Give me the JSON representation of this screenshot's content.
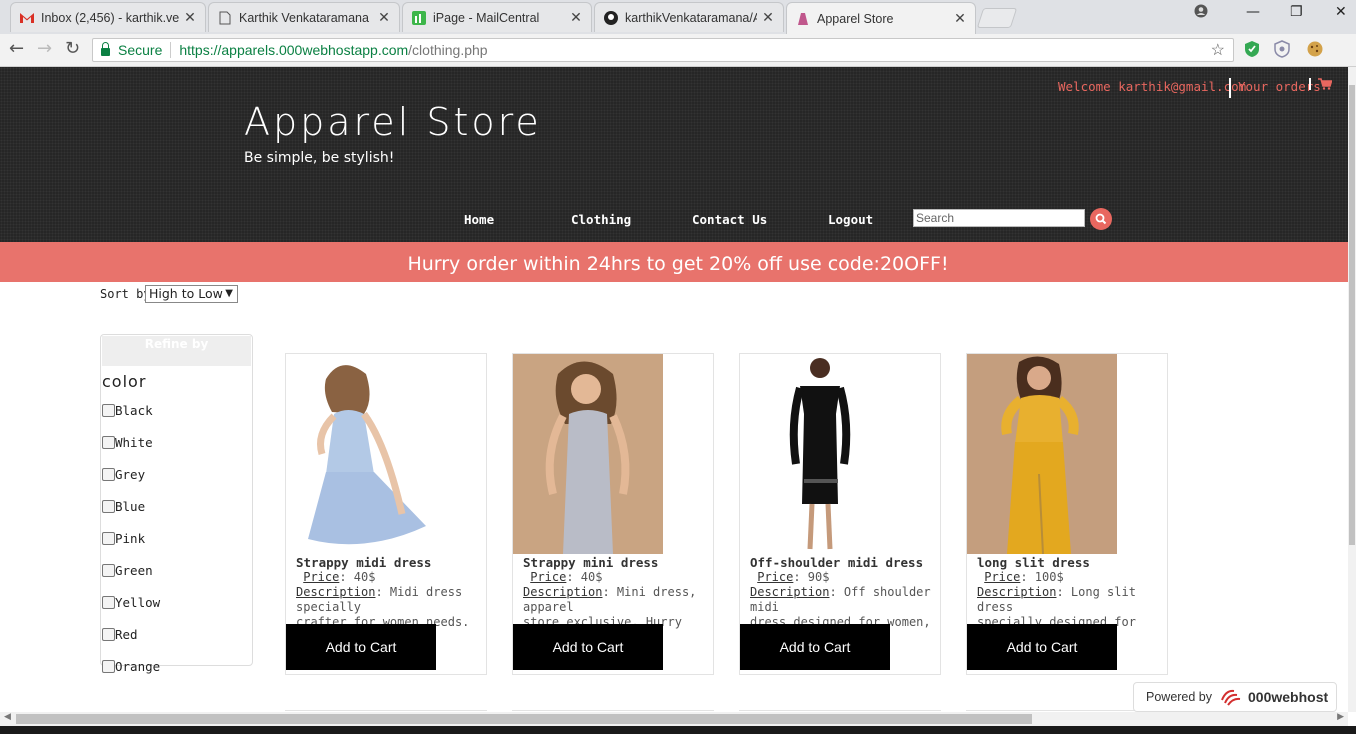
{
  "browser": {
    "tabs": [
      {
        "title": "Inbox (2,456) - karthik.ve",
        "icon": "gmail-icon"
      },
      {
        "title": "Karthik Venkataramana P",
        "icon": "document-icon"
      },
      {
        "title": "iPage - MailCentral",
        "icon": "ipage-icon"
      },
      {
        "title": "karthikVenkataramana/Ap",
        "icon": "github-icon"
      },
      {
        "title": "Apparel Store",
        "icon": "apparel-favicon-icon"
      }
    ],
    "secure_label": "Secure",
    "url_host": "https://apparels.000webhostapp.com",
    "url_path": "/clothing.php"
  },
  "header": {
    "brand": "Apparel Store",
    "tagline": "Be simple, be stylish!",
    "welcome": "Welcome karthik@gmail.com",
    "orders": "Your orders",
    "nav": [
      "Home",
      "Clothing",
      "Contact Us",
      "Logout"
    ],
    "search_placeholder": "Search"
  },
  "promo": "Hurry order within 24hrs to get 20% off use code:20OFF!",
  "sort": {
    "label": "Sort by",
    "selected": "High to Low"
  },
  "refine": {
    "title": "Refine by",
    "section": "color",
    "colors": [
      "Black",
      "White",
      "Grey",
      "Blue",
      "Pink",
      "Green",
      "Yellow",
      "Red",
      "Orange"
    ]
  },
  "products": [
    {
      "name": "Strappy midi dress",
      "price_label": "Price",
      "price": ": 40$",
      "desc_label": "Description",
      "desc1": ": Midi dress specially",
      "desc2": "crafter for women needs.",
      "button": "Add to Cart"
    },
    {
      "name": "Strappy mini dress",
      "price_label": "Price",
      "price": ": 40$",
      "desc_label": "Description",
      "desc1": ": Mini dress, apparel",
      "desc2": "store exclusive, Hurry",
      "button": "Add to Cart"
    },
    {
      "name": "Off-shoulder midi dress",
      "price_label": "Price",
      "price": ": 90$",
      "desc_label": "Description",
      "desc1": ": Off shoulder midi",
      "desc2": "dress designed for women,",
      "button": "Add to Cart"
    },
    {
      "name": "long slit dress",
      "price_label": "Price",
      "price": ": 100$",
      "desc_label": "Description",
      "desc1": ": Long slit dress",
      "desc2": "specially designed for women.",
      "button": "Add to Cart"
    }
  ],
  "footer": {
    "powered_by": "Powered by",
    "host": "000webhost"
  },
  "colors": {
    "accent": "#e8675f",
    "header_bg": "#262626",
    "promo_bg": "#e8736c"
  }
}
